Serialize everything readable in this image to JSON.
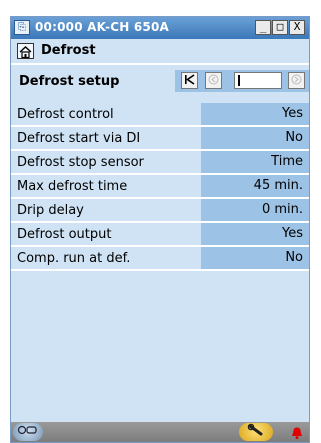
{
  "window": {
    "title": "00:000 AK-CH 650A",
    "controls": [
      "_",
      "□",
      "X"
    ]
  },
  "header": {
    "title": "Defrost"
  },
  "section": {
    "title": "Defrost setup",
    "nav": {
      "first": "K",
      "prev": "‹",
      "next": "›"
    }
  },
  "rows": [
    {
      "label": "Defrost control",
      "value": "Yes"
    },
    {
      "label": "Defrost start via DI",
      "value": "No"
    },
    {
      "label": "Defrost stop sensor",
      "value": "Time"
    },
    {
      "label": "Max defrost time",
      "value": "45 min."
    },
    {
      "label": "Drip delay",
      "value": "0 min."
    },
    {
      "label": "Defrost output",
      "value": "Yes"
    },
    {
      "label": "Comp. run at def.",
      "value": "No"
    }
  ],
  "icons": {
    "app": "app-icon",
    "home": "home-icon",
    "status_left": "service-icon",
    "status_tool": "tool-icon",
    "alarm": "alarm-bell-icon"
  },
  "colors": {
    "panel": "#cfe3f5",
    "value_cell": "#9cc3e6",
    "titlebar": "#3b78b8",
    "alarm": "#e00000"
  }
}
